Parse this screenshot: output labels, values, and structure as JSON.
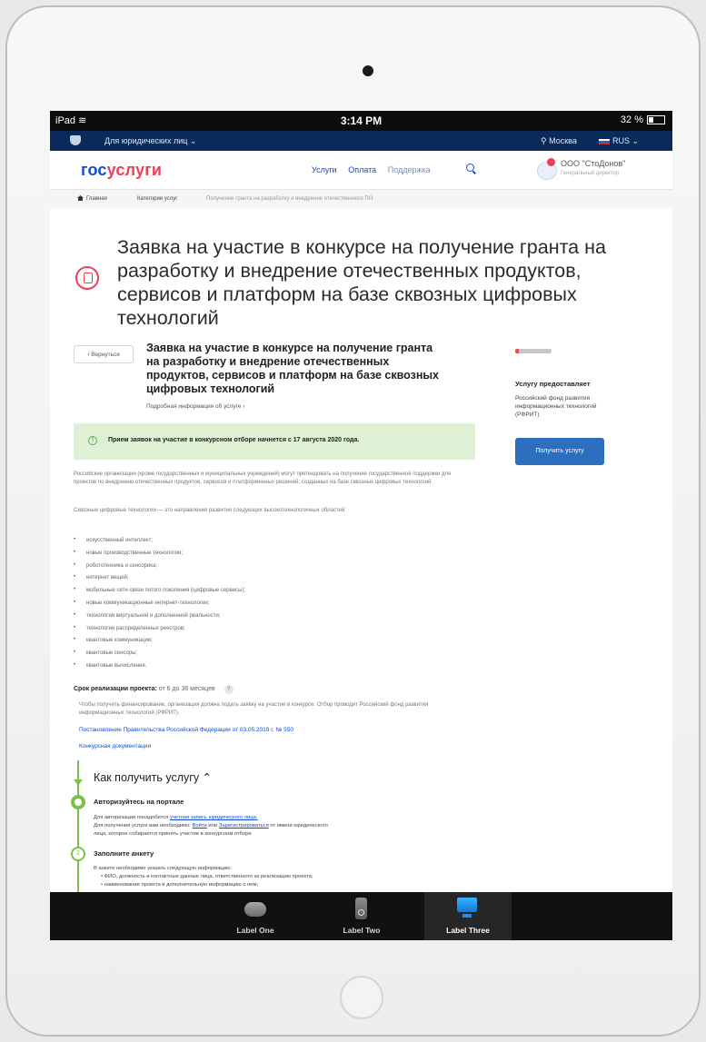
{
  "ios": {
    "carrier": "iPad",
    "wifi": "≋",
    "time": "3:14 PM",
    "battery": "32 %"
  },
  "top_nav": {
    "legal": "Для юридических лиц ⌄",
    "city": "⚲ Москва",
    "lang": "RUS ⌄"
  },
  "header": {
    "logo_gos": "гос",
    "logo_usl": "услуги",
    "nav": [
      "Услуги",
      "Оплата",
      "Поддержка"
    ],
    "org_name": "ООО \"СтоДонов\"",
    "org_sub": "Генеральный директор"
  },
  "breadcrumb": [
    "Главная",
    "Категории услуг",
    "Получение гранта на разработку и внедрение отечественного ПО"
  ],
  "page": {
    "big_title": "Заявка на участие в конкурсе на получение гранта на разработку и внедрение отечественных  продуктов, сервисов и платформ на базе  сквозных цифровых технологий",
    "back": "‹  Вернуться",
    "service_title": "Заявка на участие в конкурсе на получение гранта на разработку и внедрение отечественных  продуктов, сервисов и платформ на базе  сквозных цифровых технологий",
    "more_link": "Подробная информация об услуге  ›",
    "provider_heading": "Услугу предоставляет",
    "provider_name": "Российский фонд развития информационных технологий (РФРИТ)",
    "get_button": "Получить услугу",
    "notice": "Прием заявок на участие в конкурсном отборе начнется с 17 августа 2020 года.",
    "intro": "Российские организации (кроме государственных и муниципальных учреждений) могут претендовать на получение государственной поддержки для проектов по внедрению отечественных продуктов, сервисов и платформенных решений, созданных на базе сквозных цифровых технологий.",
    "tech_intro": "Сквозные цифровые технологии — это направления развития следующих высокотехнологичных областей:",
    "technologies": [
      "искусственный интеллект;",
      "новые производственные технологии;",
      "робототехника и сенсорика;",
      "интернет вещей;",
      "мобильные сети связи пятого поколения (цифровые сервисы);",
      "новые коммуникационные интернет-технологии;",
      "технологии виртуальной и дополненной реальности;",
      "технологии распределенных реестров;",
      "квантовые коммуникации;",
      "квантовые сенсоры;",
      "квантовые вычисления."
    ],
    "term_label": "Срок реализации проекта:",
    "term_value": "от 6 до 36 месяцев",
    "funding_text": "Чтобы получить финансирование, организация должна подать заявку на участие в конкурсе. Отбор проводит Российский фонд развития информационных технологий (РФРИТ).",
    "decree_link": "Постановление Правительства Российской Федерации от 03.05.2019 г. № 550",
    "docs_link": "Конкурсная документация",
    "how_title": "Как получить услугу  ⌃",
    "step1_title": "Авторизуйтесь на портале",
    "step1_line1_a": "Для авторизации понадобится ",
    "step1_line1_link": "учетная запись юридического лица.",
    "step1_line2_a": "Для получения услуги вам необходимо: ",
    "step1_login": "Войти",
    "step1_or": " или ",
    "step1_register": "Зарегистрироваться",
    "step1_line2_b": " от имени юридического",
    "step1_line3": "лица, которое собирается принять участие в конкурсном отборе",
    "step2_number": "2",
    "step2_title": "Заполните анкету",
    "step2_line1": "В анкете необходимо указать следующую информацию:",
    "step2_bullet1": "•  ФИО, должность и контактные данные лица, ответственного за реализацию проекта;",
    "step2_bullet2": "•  наименование проекта и дополнительную информацию о нем;"
  },
  "tabbar": {
    "tabs": [
      "Label One",
      "Label Two",
      "Label Three"
    ],
    "active": "Label Three"
  },
  "colors": {
    "brand_blue": "#0d4cd3",
    "brand_red": "#ee3f58",
    "dark_nav": "#0b2a5c",
    "notice_bg": "#dff1d4",
    "step_green": "#7cc04b"
  }
}
